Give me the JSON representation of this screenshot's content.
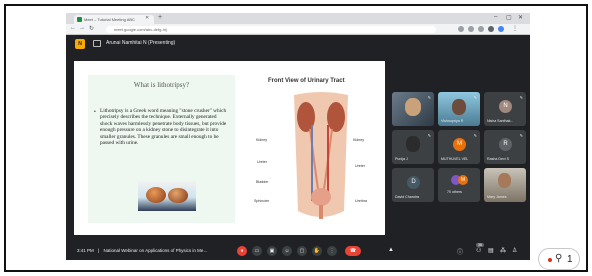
{
  "browser": {
    "tab_title": "Meet – Tutorial Meeting ABC",
    "omnibox_url": "meet.google.com/abc-defg-hij",
    "window_controls": [
      "–",
      "▢",
      "✕"
    ]
  },
  "meeting": {
    "presenter_initial": "N",
    "presenting_label": "Arunai Namhitai N (Presenting)"
  },
  "slide": {
    "title": "What is lithotripsy?",
    "bullet": "•",
    "body": "Lithotripsy is a Greek word meaning \"stone crusher\" which precisely describes the technique. Externally generated shock waves harmlessly penetrate body tissues, but provide enough pressure on a kidney stone to disintegrate it into smaller granules. These granules are small enough to be passed with urine.",
    "diagram_title": "Front View of Urinary Tract",
    "diagram_labels": {
      "kidney_left": "Kidney",
      "kidney_right": "Kidney",
      "ureter_left": "Ureter",
      "ureter_right": "Ureter",
      "bladder": "Bladder",
      "sphincter": "Sphincter",
      "urethra": "Urethra"
    }
  },
  "participants": [
    {
      "name": "",
      "kind": "video"
    },
    {
      "name": "Vishnupriya R",
      "kind": "video"
    },
    {
      "name": "Nisha Santhak...",
      "kind": "avatar",
      "initial": "N",
      "color": "#a1887f"
    },
    {
      "name": "Punija J",
      "kind": "video-dark"
    },
    {
      "name": "MUTHUVEL VEL",
      "kind": "avatar",
      "initial": "M",
      "color": "#e8710a"
    },
    {
      "name": "Rasha Devi S",
      "kind": "avatar",
      "initial": "R",
      "color": "#5f6368"
    },
    {
      "name": "David Chandra",
      "kind": "avatar",
      "initial": "D",
      "color": "#455a64"
    },
    {
      "name": "70 others",
      "kind": "others",
      "initial": "M"
    },
    {
      "name": "Mary James",
      "kind": "video"
    }
  ],
  "bottom_bar": {
    "time": "3:41 PM",
    "separator": "|",
    "meeting_title": "National Webinar on Applications of Physics in Me...",
    "badge_count": "36"
  },
  "people_button": {
    "count": "1"
  }
}
